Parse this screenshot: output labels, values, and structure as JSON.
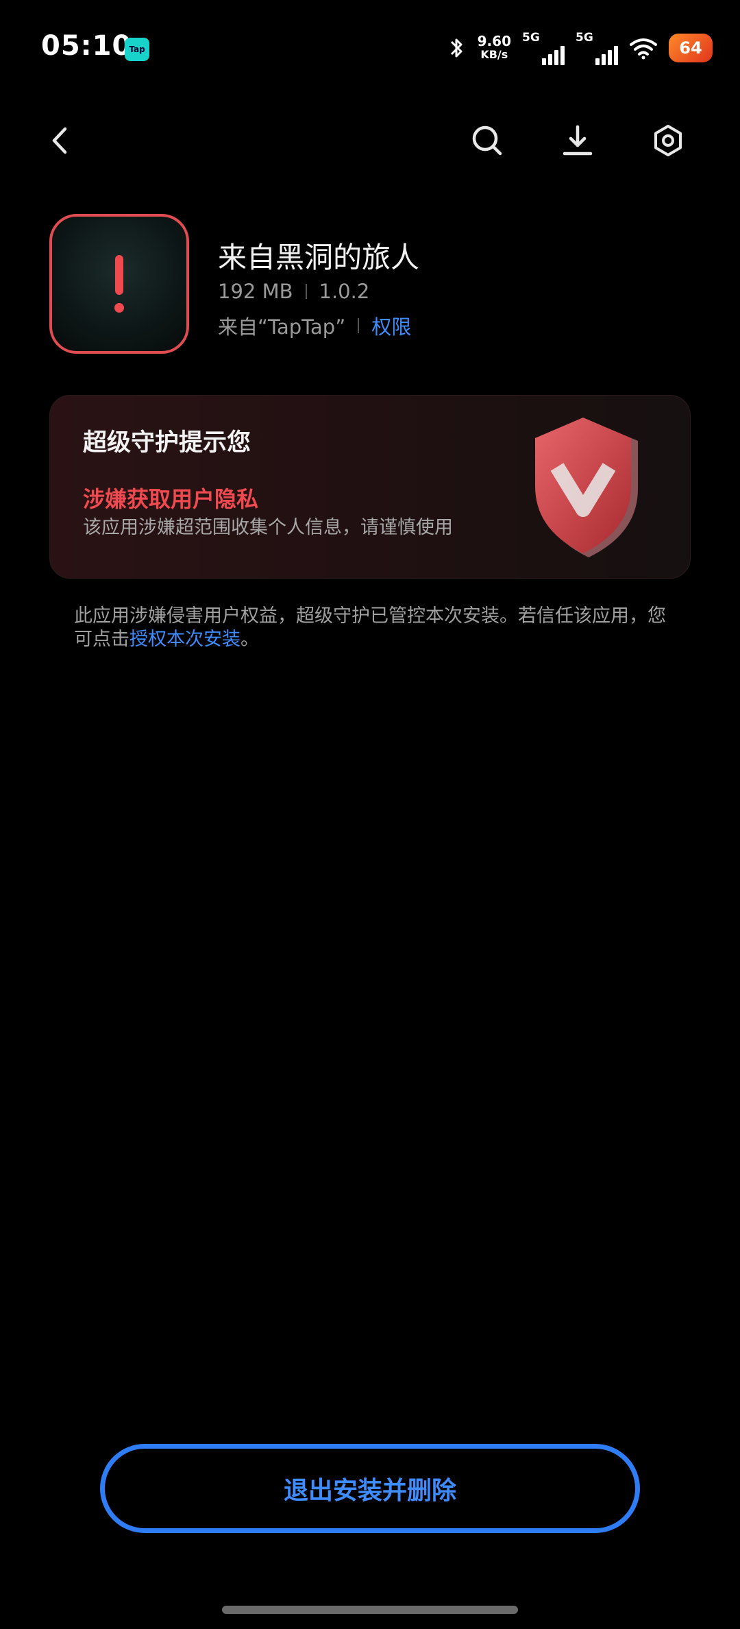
{
  "status": {
    "time": "05:10",
    "app_badge": "Tap",
    "net_speed": "9.60",
    "net_unit": "KB/s",
    "sim1": "5G",
    "sim2": "5G",
    "battery": "64"
  },
  "nav": {
    "icons": [
      "back-icon",
      "search-icon",
      "download-icon",
      "settings-icon"
    ]
  },
  "app": {
    "name": "来自黑洞的旅人",
    "size": "192 MB",
    "version": "1.0.2",
    "source": "来自“TapTap”",
    "permissions_link": "权限"
  },
  "warning": {
    "title": "超级守护提示您",
    "risk": "涉嫌获取用户隐私",
    "description": "该应用涉嫌超范围收集个人信息，请谨慎使用"
  },
  "notice": {
    "text": "此应用涉嫌侵害用户权益，超级守护已管控本次安装。若信任该应用，您可点击",
    "link": "授权本次安装",
    "end": "。"
  },
  "actions": {
    "exit_label": "退出安装并删除"
  },
  "colors": {
    "accent": "#3f8cff",
    "danger": "#ef4a50",
    "background": "#000000"
  }
}
